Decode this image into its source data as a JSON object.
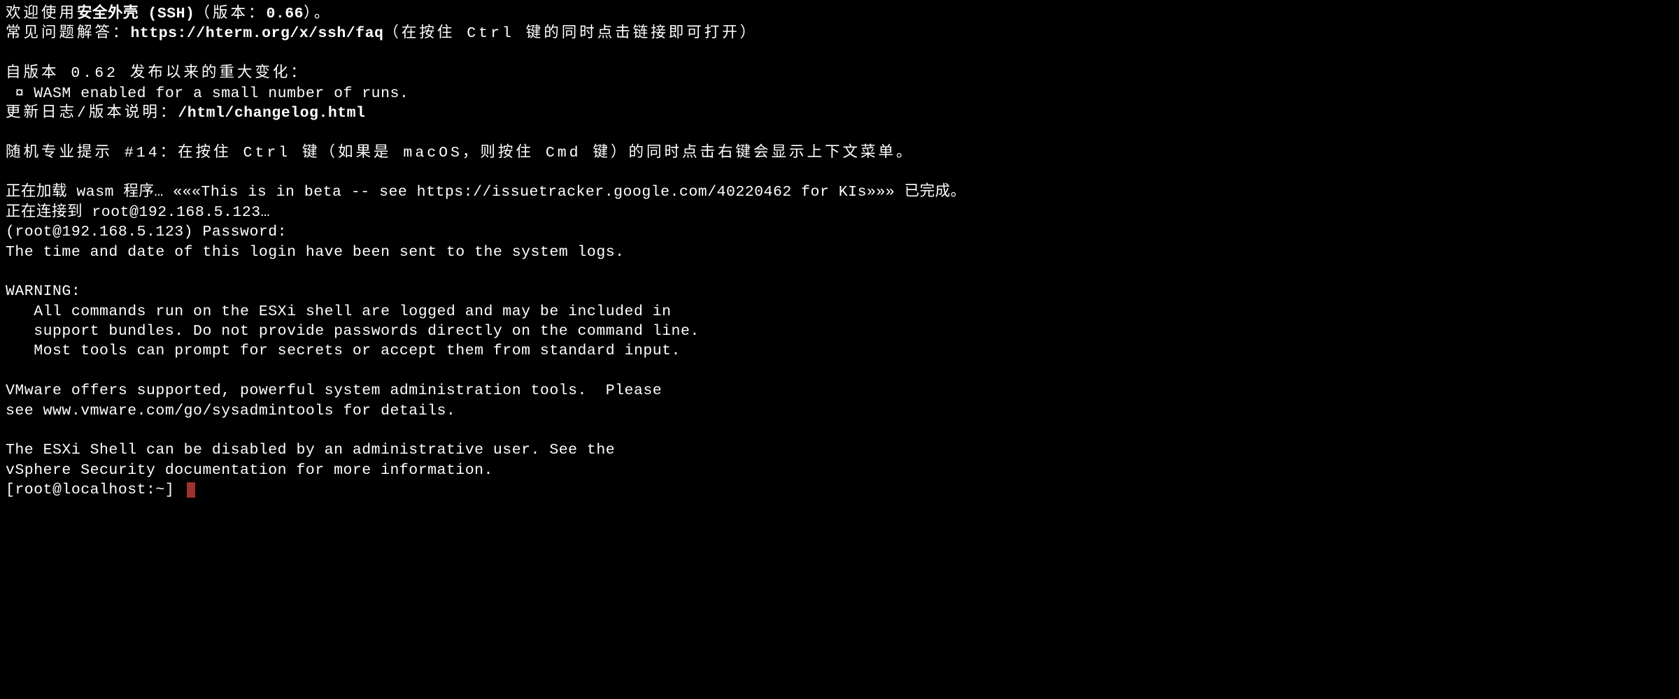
{
  "welcome": {
    "prefix": "欢迎使用",
    "app_bold": "安全外壳 (SSH)",
    "version_open": "（版本：",
    "version_bold": "0.66",
    "version_close": "）。"
  },
  "faq": {
    "prefix": "常见问题解答：",
    "url": "https://hterm.org/x/ssh/faq",
    "hint": "（在按住 Ctrl 键的同时点击链接即可打开）"
  },
  "since": "自版本 0.62 发布以来的重大变化：",
  "bullet_wasm": " ¤ WASM enabled for a small number of runs.",
  "changelog": {
    "prefix": "更新日志/版本说明：",
    "path": "/html/changelog.html"
  },
  "pro_tip": "随机专业提示 #14：在按住 Ctrl 键（如果是 macOS，则按住 Cmd 键）的同时点击右键会显示上下文菜单。",
  "loading_wasm": "正在加载 wasm 程序… «««This is in beta -- see https://issuetracker.google.com/40220462 for KIs»»» 已完成。",
  "connecting": "正在连接到 root@192.168.5.123…",
  "password_prompt": "(root@192.168.5.123) Password:",
  "login_logged": "The time and date of this login have been sent to the system logs.",
  "warning": {
    "header": "WARNING:",
    "l1": "   All commands run on the ESXi shell are logged and may be included in",
    "l2": "   support bundles. Do not provide passwords directly on the command line.",
    "l3": "   Most tools can prompt for secrets or accept them from standard input."
  },
  "vmware": {
    "l1": "VMware offers supported, powerful system administration tools.  Please",
    "l2": "see www.vmware.com/go/sysadmintools for details."
  },
  "shell_note": {
    "l1": "The ESXi Shell can be disabled by an administrative user. See the",
    "l2": "vSphere Security documentation for more information."
  },
  "prompt": "[root@localhost:~] "
}
